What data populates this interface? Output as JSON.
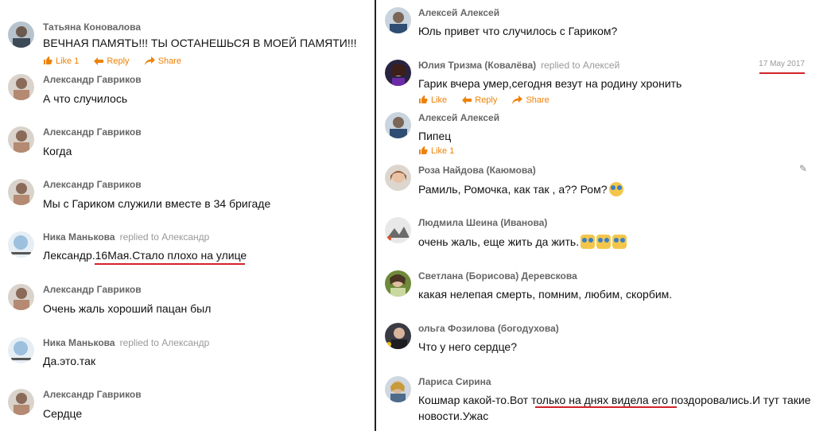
{
  "left": [
    {
      "author": "Татьяна Коновалова",
      "text": "ВЕЧНАЯ ПАМЯТЬ!!! ТЫ ОСТАНЕШЬСЯ В МОЕЙ ПАМЯТИ!!!",
      "actions": {
        "like": "Like 1",
        "reply": "Reply",
        "share": "Share"
      }
    },
    {
      "author": "Александр Гавриков",
      "text": "А что случилось"
    },
    {
      "author": "Александр Гавриков",
      "text": "Когда"
    },
    {
      "author": "Александр Гавриков",
      "text": "Мы с Гариком служили вместе в 34 бригаде"
    },
    {
      "author": "Ника Манькова",
      "replied": "replied to Александр",
      "text": "Лександр.16Мая.Стало плохо на улице"
    },
    {
      "author": "Александр Гавриков",
      "text": "Очень жаль хороший пацан был"
    },
    {
      "author": "Ника Манькова",
      "replied": "replied to Александр",
      "text": "Да.это.так"
    },
    {
      "author": "Александр Гавриков",
      "text": "Сердце"
    }
  ],
  "right": [
    {
      "author": "Алексей Алексей",
      "text": "Юль привет что случилось с Гариком?"
    },
    {
      "author": "Юлия Тризма (Ковалёва)",
      "replied": "replied to Алексей",
      "date": "17 May 2017",
      "text": "Гарик вчера умер,сегодня везут на родину хронить",
      "actions": {
        "like": "Like",
        "reply": "Reply",
        "share": "Share"
      }
    },
    {
      "author": "Алексей Алексей",
      "text": "Пипец",
      "actions": {
        "like": "Like 1"
      }
    },
    {
      "author": "Роза Найдова (Каюмова)",
      "text": "Рамиль, Ромочка,  как так , а?? Ром?"
    },
    {
      "author": "Людмила Шеина (Иванова)",
      "text": "очень жаль, еще жить да жить."
    },
    {
      "author": "Светлана (Борисова) Деревскова",
      "text": "какая нелепая смерть, помним, любим, скорбим."
    },
    {
      "author": "ольга Фозилова (богодухова)",
      "text": "Что у него сердце?"
    },
    {
      "author": "Лариса Сирина",
      "text": "Кошмар какой-то.Вот только на днях видела его поздоровались.И тут такие новости.Ужас"
    }
  ],
  "colors": {
    "accent": "#ee8208",
    "underline": "#d2232a",
    "author": "#666666",
    "text": "#111111"
  },
  "icons": [
    "like-icon",
    "reply-icon",
    "share-icon",
    "pencil-icon",
    "crying-emoji-icon"
  ]
}
